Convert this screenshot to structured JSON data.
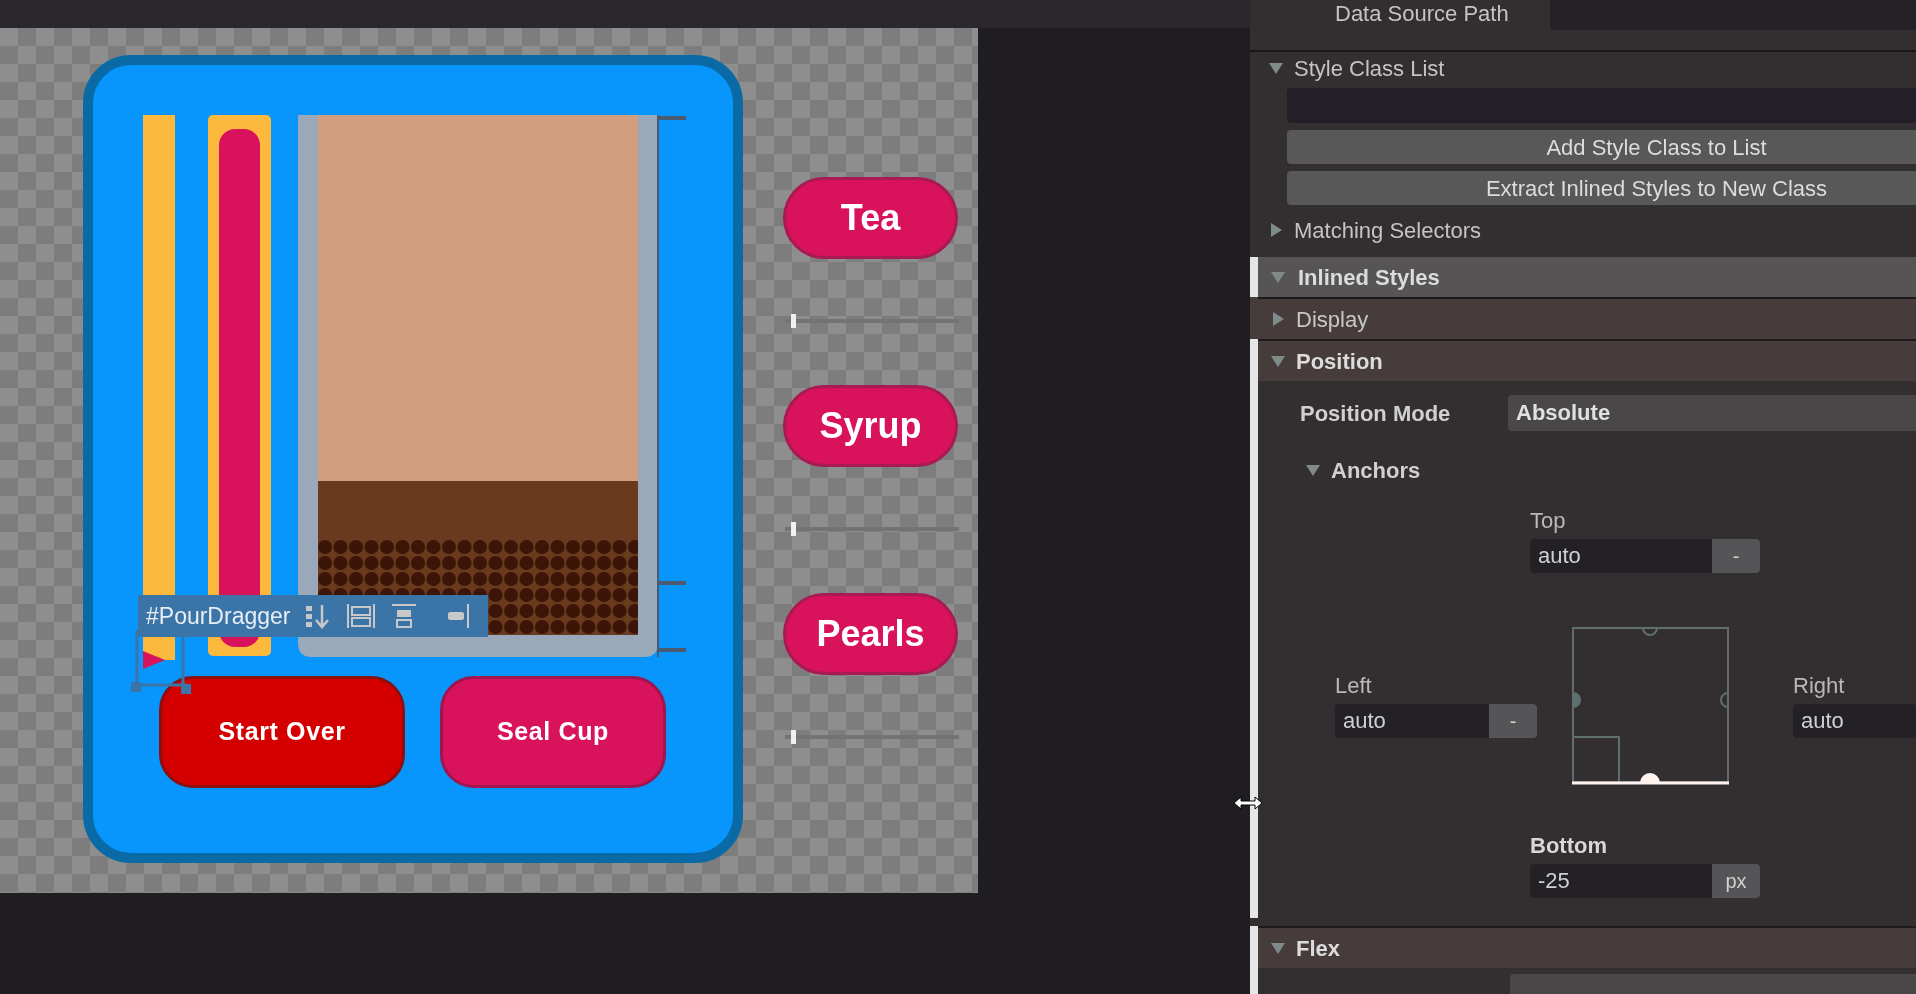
{
  "canvas": {
    "cup_panel": {
      "selection_label": "#PourDragger",
      "buttons": [
        {
          "label": "Start Over",
          "kind": "reset"
        },
        {
          "label": "Seal Cup",
          "kind": "action"
        }
      ]
    },
    "ingredients": [
      {
        "label": "Tea",
        "level": 0
      },
      {
        "label": "Syrup",
        "level": 0
      },
      {
        "label": "Pearls",
        "level": 0
      }
    ]
  },
  "inspector": {
    "data_source_path": {
      "label": "Data Source Path"
    },
    "style_class_list": {
      "label": "Style Class List",
      "expanded": true,
      "buttons": [
        "Add Style Class to List",
        "Extract Inlined Styles to New Class"
      ]
    },
    "matching_selectors": {
      "label": "Matching Selectors",
      "expanded": false
    },
    "inlined_styles": {
      "label": "Inlined Styles",
      "expanded": true
    },
    "sections": [
      {
        "kind": "display",
        "label": "Display",
        "expanded": false,
        "overridden": false
      },
      {
        "kind": "position",
        "label": "Position",
        "expanded": true,
        "overridden": true
      },
      {
        "kind": "flex",
        "label": "Flex",
        "expanded": true,
        "overridden": true
      }
    ],
    "position": {
      "mode": {
        "label": "Position Mode",
        "value": "Absolute"
      },
      "anchors": {
        "label": "Anchors",
        "expanded": true,
        "top": {
          "label": "Top",
          "value": "auto",
          "unit": "-",
          "overridden": false
        },
        "left": {
          "label": "Left",
          "value": "auto",
          "unit": "-",
          "overridden": false
        },
        "right": {
          "label": "Right",
          "value": "auto",
          "overridden": false
        },
        "bottom": {
          "label": "Bottom",
          "value": "-25",
          "unit": "px",
          "overridden": true
        }
      }
    }
  }
}
